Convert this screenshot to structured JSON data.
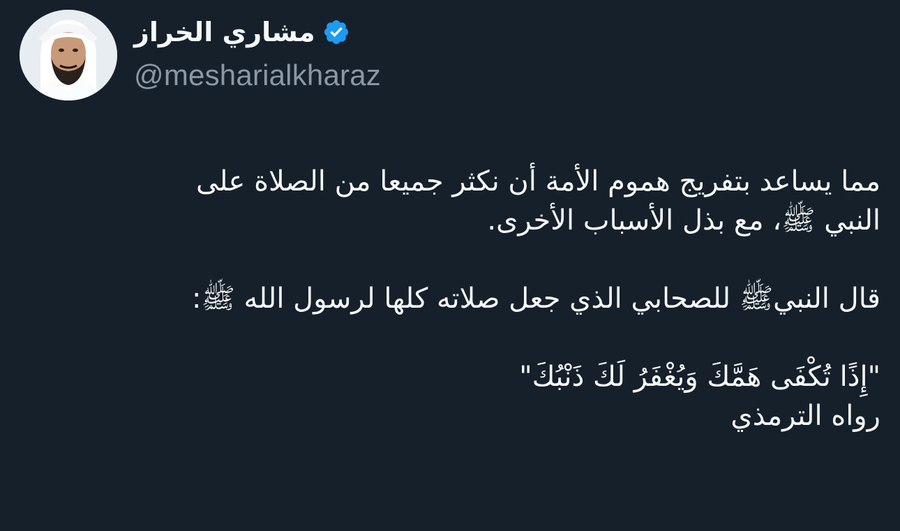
{
  "author": {
    "display_name": "مشاري الخراز",
    "handle": "@mesharialkharaz",
    "verified": true,
    "verified_color": "#1d9bf0",
    "avatar_icon": "profile-photo"
  },
  "tweet": {
    "paragraph_1": "مما يساعد بتفريج هموم الأمة أن نكثر جميعا من الصلاة على\nالنبي ﷺ، مع بذل الأسباب الأخرى.",
    "paragraph_2": "قال النبيﷺ للصحابي الذي جعل صلاته كلها لرسول الله ﷺ:",
    "quote": "\"إِذًا تُكْفَى هَمَّكَ وَيُغْفَرُ لَكَ ذَنْبُكَ\"",
    "source": "رواه الترمذي"
  },
  "colors": {
    "background": "#15202b",
    "text_primary": "#f7f9f9",
    "text_secondary": "#8b98a5"
  }
}
